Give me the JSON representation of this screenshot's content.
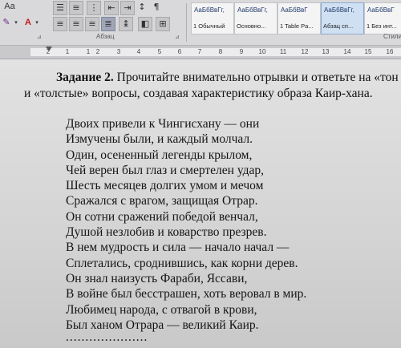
{
  "ribbon": {
    "top_labels": [
      "Aa",
      "Ā",
      "A"
    ],
    "paragraph_group_label": "Абзац",
    "styles_label": "Стили",
    "styles": [
      {
        "sample": "АаБбВвГг,",
        "name": "1 Обычный"
      },
      {
        "sample": "АаБбВвГг,",
        "name": "Основно..."
      },
      {
        "sample": "АаБбВвГ",
        "name": "1 Table Pa..."
      },
      {
        "sample": "АаБбВвГг,",
        "name": "Абзац сп..."
      },
      {
        "sample": "АаБбВвГ",
        "name": "1 Без инт..."
      }
    ]
  },
  "ruler": {
    "numbers": [
      "2",
      "1",
      "1",
      "2",
      "3",
      "4",
      "5",
      "6",
      "7",
      "8",
      "9",
      "10",
      "11",
      "12",
      "13",
      "14",
      "15",
      "16"
    ]
  },
  "document": {
    "task_bold": "Задание 2.",
    "task_rest": " Прочитайте внимательно отрывки и ответьте на «тон",
    "task_line2": "и «толстые» вопросы, создавая характеристику образа Каир-хана.",
    "poem": [
      "Двоих привели к Чингисхану — они",
      "Измучены были, и каждый молчал.",
      "Один, осененный легенды крылом,",
      "Чей верен был глаз и смертелен удар,",
      "Шесть месяцев долгих умом и мечом",
      "Сражался с врагом, защищая Отрар.",
      "Он сотни сражений победой венчал,",
      "Душой незлобив и коварство презрев.",
      "В нем мудрость и сила — начало начал —",
      "Сплетались, сроднившись, как корни дерев.",
      "Он знал наизусть Фараби, Яссави,",
      "В войне был бесстрашен, хоть веровал в мир.",
      "Любимец народа, с отвагой в крови,",
      "Был ханом Отрара — великий Каир."
    ],
    "trailing_dots": "....................."
  }
}
